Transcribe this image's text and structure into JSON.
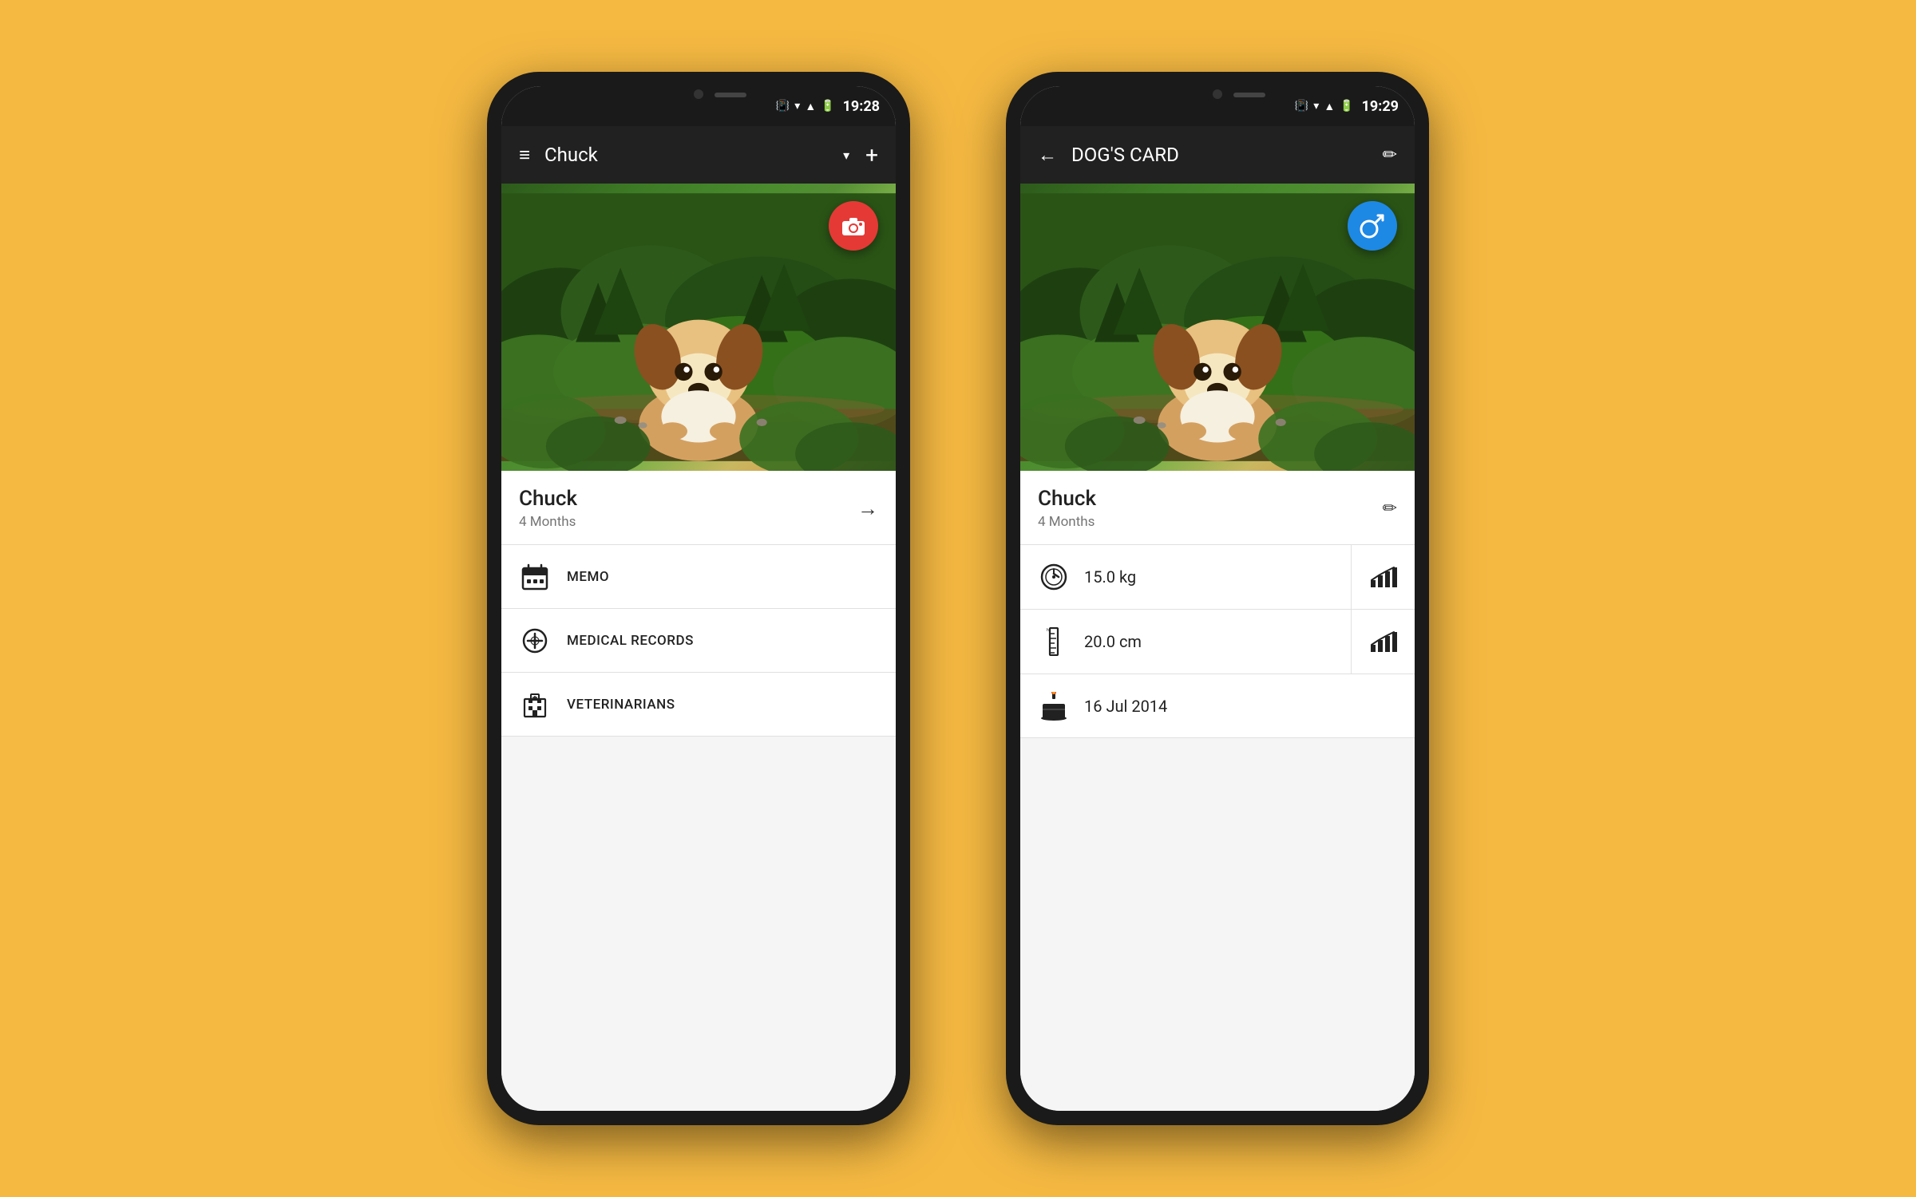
{
  "background_color": "#F5B942",
  "phone1": {
    "status_bar": {
      "time": "19:28",
      "icons": [
        "vibrate",
        "wifi",
        "signal",
        "battery"
      ]
    },
    "app_bar": {
      "title": "Chuck",
      "menu_label": "≡",
      "dropdown_label": "▾",
      "add_label": "+"
    },
    "dog_image": {
      "alt": "Dog Chuck peeking through bushes"
    },
    "camera_fab": {
      "icon": "camera"
    },
    "dog_card": {
      "name": "Chuck",
      "age": "4 Months",
      "arrow": "→"
    },
    "menu_items": [
      {
        "id": "memo",
        "label": "MEMO",
        "icon": "calendar"
      },
      {
        "id": "medical",
        "label": "MEDICAL RECORDS",
        "icon": "medical"
      },
      {
        "id": "vets",
        "label": "VETERINARIANS",
        "icon": "hospital"
      }
    ]
  },
  "phone2": {
    "status_bar": {
      "time": "19:29",
      "icons": [
        "vibrate",
        "wifi",
        "signal",
        "battery"
      ]
    },
    "app_bar": {
      "back_label": "←",
      "title": "DOG'S CARD",
      "edit_label": "✏"
    },
    "dog_image": {
      "alt": "Dog Chuck peeking through bushes"
    },
    "male_fab": {
      "icon": "♂"
    },
    "dog_card": {
      "name": "Chuck",
      "age": "4 Months",
      "edit_label": "✏"
    },
    "stats": [
      {
        "id": "weight",
        "icon": "scale",
        "value": "15.0 kg"
      },
      {
        "id": "height",
        "icon": "ruler",
        "value": "20.0 cm"
      }
    ],
    "birthday": {
      "icon": "cake",
      "value": "16 Jul 2014"
    }
  }
}
